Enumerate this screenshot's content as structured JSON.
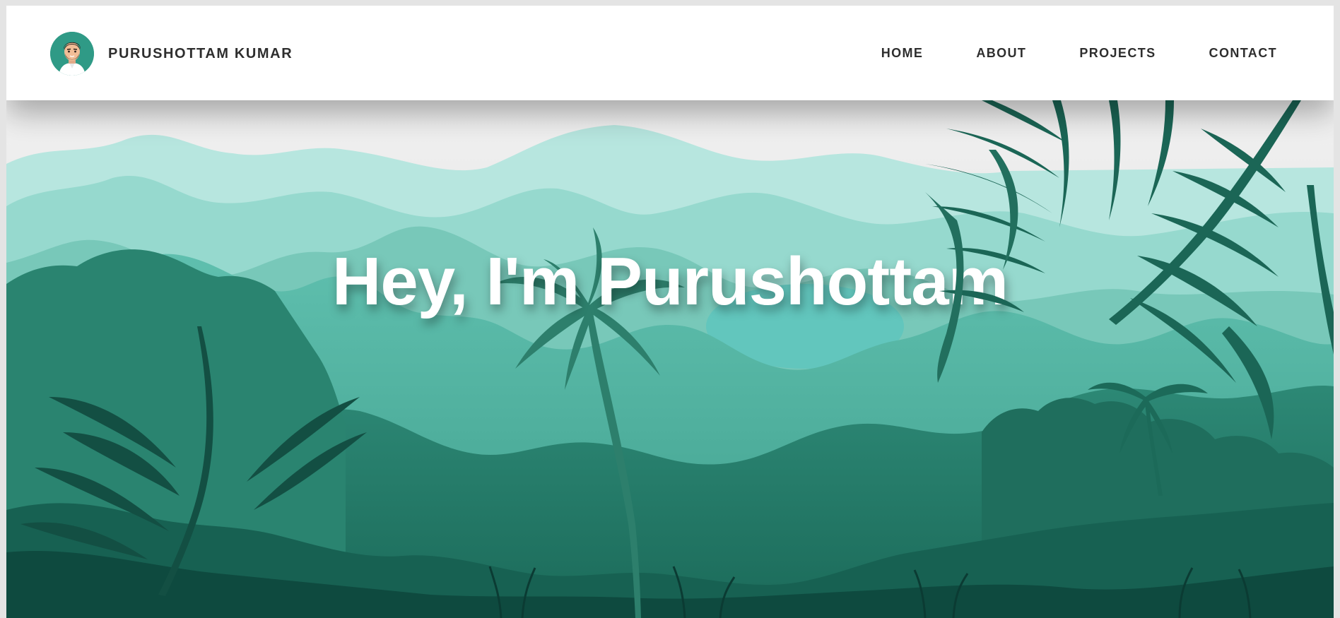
{
  "navbar": {
    "brand_name": "PURUSHOTTAM KUMAR",
    "avatar_icon": "avatar-cartoon-man-icon",
    "links": [
      {
        "label": "HOME"
      },
      {
        "label": "ABOUT"
      },
      {
        "label": "PROJECTS"
      },
      {
        "label": "CONTACT"
      }
    ]
  },
  "hero": {
    "title": "Hey, I'm Purushottam",
    "illustration": "jungle-landscape-illustration"
  },
  "colors": {
    "text_dark": "#2e2e2e",
    "mint_light": "#b7e6df",
    "teal_mid": "#4fae9a",
    "teal_dark": "#1d6c5a",
    "forest_deep": "#0a3a32"
  }
}
